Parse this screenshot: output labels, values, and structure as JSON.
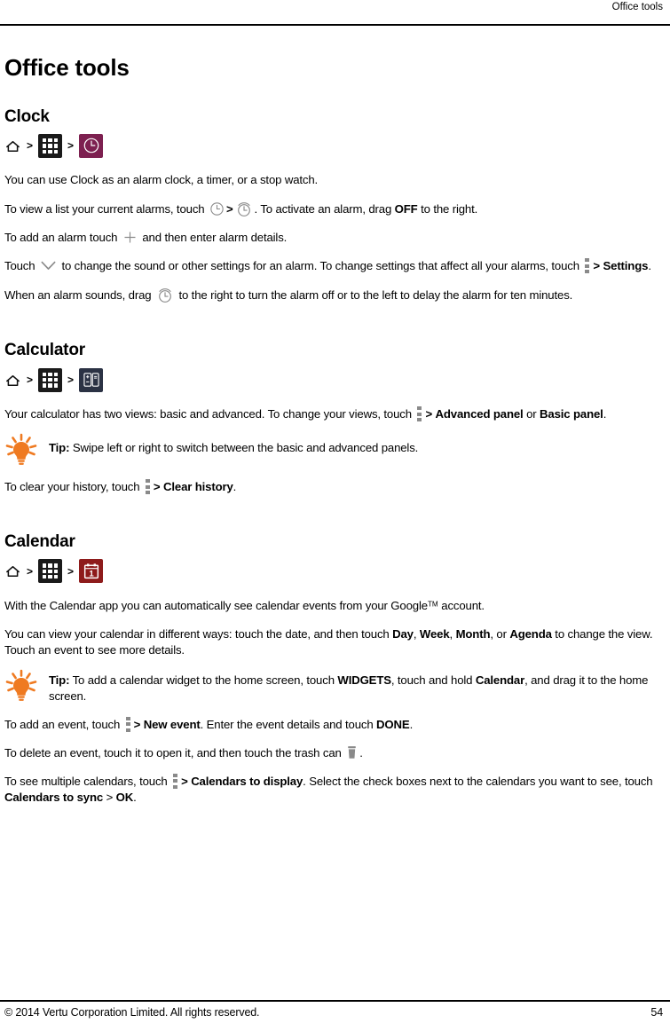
{
  "header": {
    "running_title": "Office tools"
  },
  "page_title": "Office tools",
  "sections": {
    "clock": {
      "title": "Clock",
      "breadcrumb": {
        "home_icon": "home-icon",
        "separator": ">",
        "apps_icon": "apps-grid-icon",
        "app_icon": "clock-app-icon"
      },
      "p1": "You can use Clock as an alarm clock, a timer, or a stop watch.",
      "p2_a": "To view a list your current alarms, touch ",
      "p2_sep": ">",
      "p2_b": ". To activate an alarm, drag ",
      "p2_bold": "OFF",
      "p2_c": " to the right.",
      "p3_a": "To add an alarm touch ",
      "p3_b": " and then enter alarm details.",
      "p4_a": "Touch ",
      "p4_b": " to change the sound or other settings for an alarm. To change settings that affect all your alarms, touch ",
      "p4_sep": ">",
      "p4_bold": "Settings",
      "p4_c": ".",
      "p5_a": "When an alarm sounds, drag ",
      "p5_b": " to the right to turn the alarm off or to the left to delay the alarm for ten minutes."
    },
    "calculator": {
      "title": "Calculator",
      "breadcrumb": {
        "home_icon": "home-icon",
        "separator": ">",
        "apps_icon": "apps-grid-icon",
        "app_icon": "calculator-app-icon"
      },
      "p1_a": "Your calculator has two views: basic and advanced. To change your views, touch ",
      "p1_sep": ">",
      "p1_bold1": "Advanced panel",
      "p1_mid": " or ",
      "p1_bold2": "Basic panel",
      "p1_c": ".",
      "tip_label": "Tip:",
      "tip_text": " Swipe left or right to switch between the basic and advanced panels.",
      "p2_a": "To clear your history, touch ",
      "p2_sep": ">",
      "p2_bold": "Clear history",
      "p2_c": "."
    },
    "calendar": {
      "title": "Calendar",
      "breadcrumb": {
        "home_icon": "home-icon",
        "separator": ">",
        "apps_icon": "apps-grid-icon",
        "app_icon": "calendar-app-icon"
      },
      "p1_a": "With the Calendar app you can automatically see calendar events from your Google",
      "p1_tm": "TM",
      "p1_b": " account.",
      "p2_a": "You can view your calendar in different ways: touch the date, and then touch ",
      "p2_b1": "Day",
      "p2_sep1": ", ",
      "p2_b2": "Week",
      "p2_sep2": ", ",
      "p2_b3": "Month",
      "p2_sep3": ", or ",
      "p2_b4": "Agenda",
      "p2_c": " to change the view. Touch an event to see more details.",
      "tip_label": "Tip:",
      "tip_a": " To add a calendar widget to the home screen, touch ",
      "tip_b1": "WIDGETS",
      "tip_mid": ", touch and hold ",
      "tip_b2": "Calendar",
      "tip_c": ", and drag it to the home screen.",
      "p3_a": "To add an event, touch ",
      "p3_sep": ">",
      "p3_bold1": "New event",
      "p3_b": ". Enter the event details and touch ",
      "p3_bold2": "DONE",
      "p3_c": ".",
      "p4_a": "To delete an event, touch it to open it, and then touch the trash can ",
      "p4_b": ".",
      "p5_a": "To see multiple calendars, touch ",
      "p5_sep": ">",
      "p5_bold1": "Calendars to display",
      "p5_b": ". Select the check boxes next to the calendars you want to see, touch ",
      "p5_bold2": "Calendars to sync",
      "p5_sep2": " > ",
      "p5_bold3": "OK",
      "p5_c": "."
    }
  },
  "footer": {
    "copyright": "© 2014 Vertu Corporation Limited. All rights reserved.",
    "page_number": "54"
  },
  "colors": {
    "clock_tile": "#7d2050",
    "calculator_tile": "#2b3244",
    "calendar_tile": "#8e1b1b",
    "apps_tile": "#1a1a1a",
    "tip_bulb": "#ef7a21",
    "icon_grey": "#8a8a8a"
  }
}
